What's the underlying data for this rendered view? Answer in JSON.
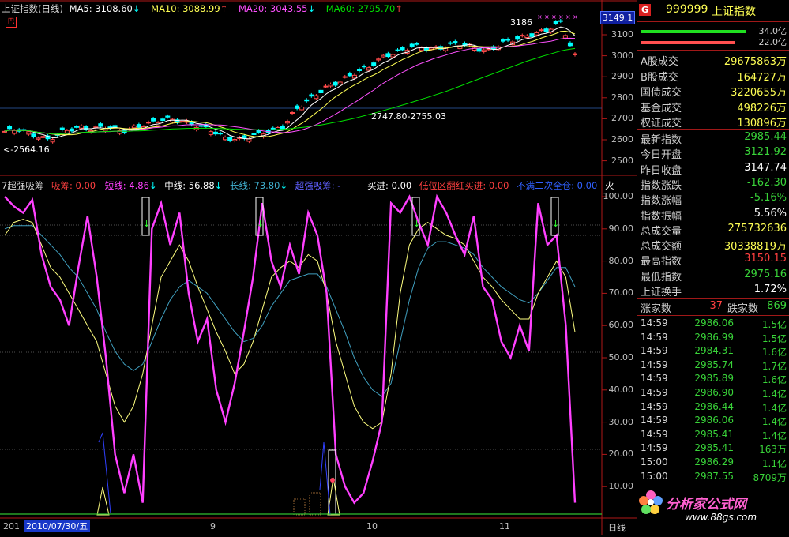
{
  "main_header": {
    "title": "上证指数(日线)",
    "ma5": "MA5: 3108.60",
    "ma10": "MA10: 3088.99",
    "ma20": "MA20: 3043.55",
    "ma60": "MA60: 2795.70"
  },
  "main_badge": "巴",
  "price_axis": [
    "3100",
    "3000",
    "2900",
    "2800",
    "2700",
    "2600",
    "2500"
  ],
  "current_price_tag": "3149.1",
  "annotations": {
    "high": "3186",
    "range": "2747.80-2755.03",
    "low": "<-2564.16"
  },
  "indicator_header": {
    "name": "7超强吸筹",
    "xichou": "吸筹: 0.00",
    "short": "短线: 4.86",
    "mid": "中线: 56.88",
    "long": "长线: 73.80",
    "super": "超强吸筹: -",
    "buy": "买进: 0.00",
    "low_zone": "低位区翻红买进: 0.00",
    "no_full": "不满二次全仓: 0.00",
    "fire": "火"
  },
  "indicator_axis": [
    "100.00",
    "90.00",
    "80.00",
    "70.00",
    "60.00",
    "50.00",
    "40.00",
    "30.00",
    "20.00",
    "10.00"
  ],
  "date_axis": {
    "start": "201",
    "selected": "2010/07/30/五",
    "months": [
      "9",
      "10",
      "11"
    ],
    "period": "日线"
  },
  "panel": {
    "icon_letter": "G",
    "code": "999999",
    "name": "上证指数",
    "bar1_value": "34.0亿",
    "bar2_value": "22.0亿",
    "stats": [
      {
        "label": "A股成交",
        "value": "29675863万",
        "color": "yellow"
      },
      {
        "label": "B股成交",
        "value": "164727万",
        "color": "yellow"
      },
      {
        "label": "国债成交",
        "value": "3220655万",
        "color": "yellow"
      },
      {
        "label": "基金成交",
        "value": "498226万",
        "color": "yellow"
      },
      {
        "label": "权证成交",
        "value": "130896万",
        "color": "yellow"
      }
    ],
    "quote": [
      {
        "label": "最新指数",
        "value": "2985.44",
        "color": "green"
      },
      {
        "label": "今日开盘",
        "value": "3121.92",
        "color": "green"
      },
      {
        "label": "昨日收盘",
        "value": "3147.74",
        "color": "white"
      },
      {
        "label": "指数涨跌",
        "value": "-162.30",
        "color": "green"
      },
      {
        "label": "指数涨幅",
        "value": "-5.16%",
        "color": "green"
      },
      {
        "label": "指数振幅",
        "value": "5.56%",
        "color": "white"
      },
      {
        "label": "总成交量",
        "value": "275732636",
        "color": "yellow"
      },
      {
        "label": "总成交额",
        "value": "30338819万",
        "color": "yellow"
      },
      {
        "label": "最高指数",
        "value": "3150.15",
        "color": "red"
      },
      {
        "label": "最低指数",
        "value": "2975.16",
        "color": "green"
      },
      {
        "label": "上证换手",
        "value": "1.72%",
        "color": "white"
      }
    ],
    "rise_label": "涨家数",
    "rise_count": "37",
    "fall_label": "跌家数",
    "fall_count": "869",
    "ticks": [
      {
        "time": "14:59",
        "price": "2986.06",
        "vol": "1.5亿"
      },
      {
        "time": "14:59",
        "price": "2986.99",
        "vol": "1.5亿"
      },
      {
        "time": "14:59",
        "price": "2984.31",
        "vol": "1.6亿"
      },
      {
        "time": "14:59",
        "price": "2985.74",
        "vol": "1.7亿"
      },
      {
        "time": "14:59",
        "price": "2985.89",
        "vol": "1.6亿"
      },
      {
        "time": "14:59",
        "price": "2986.90",
        "vol": "1.4亿"
      },
      {
        "time": "14:59",
        "price": "2986.44",
        "vol": "1.4亿"
      },
      {
        "time": "14:59",
        "price": "2986.06",
        "vol": "1.4亿"
      },
      {
        "time": "14:59",
        "price": "2985.41",
        "vol": "1.4亿"
      },
      {
        "time": "14:59",
        "price": "2985.41",
        "vol": "163万"
      },
      {
        "time": "15:00",
        "price": "2986.29",
        "vol": "1.1亿"
      },
      {
        "time": "15:00",
        "price": "2987.55",
        "vol": "8709万"
      }
    ],
    "watermark_name": "分析家公式网",
    "watermark_url": "www.88gs.com"
  },
  "colors": {
    "up": "#ff4a4a",
    "down": "#00ffff",
    "ma5": "#ffffff",
    "ma10": "#ffff54",
    "ma20": "#ff50ff",
    "ma60": "#00e000",
    "short": "#ff40ff",
    "mid": "#ffff80",
    "long": "#40a0c0"
  }
}
